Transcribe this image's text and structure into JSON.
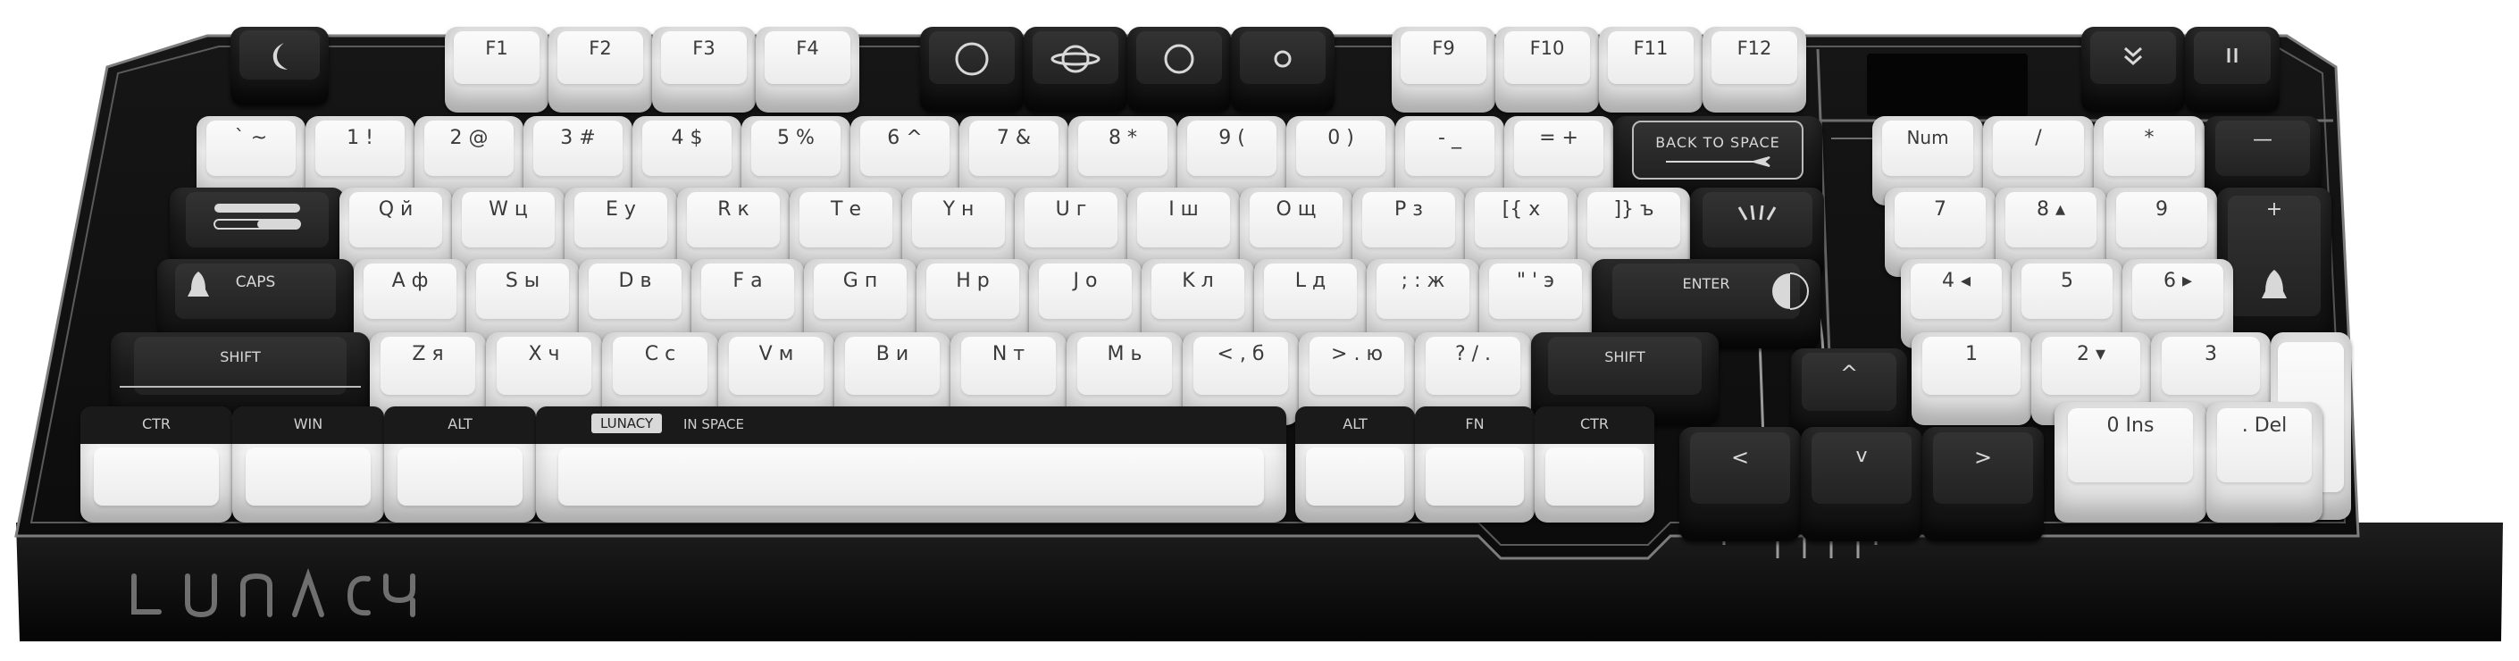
{
  "brand": {
    "logo_text": "LUNACY",
    "colors": {
      "case": "#111111",
      "trim": "#8a8a8a",
      "white_key": "#f0f0f0",
      "black_key": "#1c1c1c"
    }
  },
  "keys": {
    "esc_icon": "crescent-moon-icon",
    "f1": "F1",
    "f2": "F2",
    "f3": "F3",
    "f4": "F4",
    "f5_icon": "circle-outline-icon",
    "f6_icon": "planet-ring-icon",
    "f7_icon": "circle-outline-icon",
    "f8_icon": "small-circle-icon",
    "f9": "F9",
    "f10": "F10",
    "f11": "F11",
    "f12": "F12",
    "media1_icon": "chevron-double-down-icon",
    "media2_icon": "pause-icon",
    "grave": "` ~",
    "k1": "1 !",
    "k2": "2 @",
    "k3": "3 #",
    "k4": "4 $",
    "k5": "5 %",
    "k6": "6 ^",
    "k7": "7 &",
    "k8": "8 *",
    "k9": "9 (",
    "k0": "0 )",
    "minus": "- _",
    "equal": "= +",
    "backspace": "BACK TO SPACE",
    "tab_icon": "toggle-switch-icon",
    "q": "Q й",
    "w": "W ц",
    "e": "E у",
    "r": "R к",
    "t": "T е",
    "y": "Y н",
    "u": "U г",
    "i": "I ш",
    "o": "O щ",
    "p": "P з",
    "lbracket": "[{ х",
    "rbracket": "]} ъ",
    "caps": "CAPS",
    "a": "A ф",
    "s": "S ы",
    "d": "D в",
    "f": "F а",
    "g": "G п",
    "h": "H р",
    "j": "J о",
    "k": "K л",
    "l": "L д",
    "semicolon": "; : ж",
    "quote": "\" ' э",
    "enter": "ENTER",
    "lshift": "SHIFT",
    "z": "Z я",
    "x": "X ч",
    "c": "C с",
    "v": "V м",
    "b": "B и",
    "n": "N т",
    "m": "M ь",
    "comma": "< , б",
    "period": "> . ю",
    "slash": "? / .",
    "rshift": "SHIFT",
    "lctrl": "CTR",
    "lwin": "WIN",
    "lalt": "ALT",
    "space_badge": "LUNACY",
    "space_text": "IN SPACE",
    "ralt": "ALT",
    "fn": "FN",
    "rctrl": "CTR",
    "up": "^",
    "left": "<",
    "down": "v",
    "right": ">",
    "numlock": "Num",
    "num_slash": "/",
    "num_star": "*",
    "num_minus": "—",
    "num7": "7",
    "num8": "8 ▴",
    "num9": "9",
    "num_plus": "+",
    "num4": "4 ◂",
    "num5": "5",
    "num6": "6 ▸",
    "num1": "1",
    "num2": "2 ▾",
    "num3": "3",
    "num0": "0 Ins",
    "num_del": ". Del"
  }
}
